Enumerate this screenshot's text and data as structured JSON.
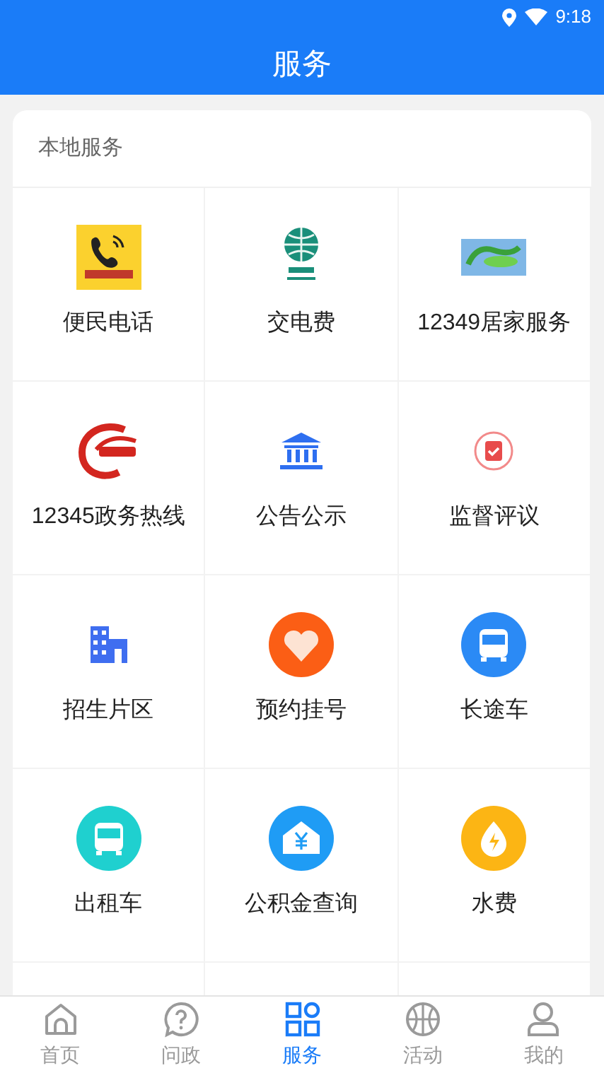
{
  "status_bar": {
    "time": "9:18"
  },
  "header": {
    "title": "服务"
  },
  "section": {
    "title": "本地服务",
    "items": [
      {
        "label": "便民电话"
      },
      {
        "label": "交电费"
      },
      {
        "label": "12349居家服务"
      },
      {
        "label": "12345政务热线"
      },
      {
        "label": "公告公示"
      },
      {
        "label": "监督评议"
      },
      {
        "label": "招生片区"
      },
      {
        "label": "预约挂号"
      },
      {
        "label": "长途车"
      },
      {
        "label": "出租车"
      },
      {
        "label": "公积金查询"
      },
      {
        "label": "水费"
      }
    ]
  },
  "tabs": [
    {
      "label": "首页",
      "selected": false
    },
    {
      "label": "问政",
      "selected": false
    },
    {
      "label": "服务",
      "selected": true
    },
    {
      "label": "活动",
      "selected": false
    },
    {
      "label": "我的",
      "selected": false
    }
  ]
}
